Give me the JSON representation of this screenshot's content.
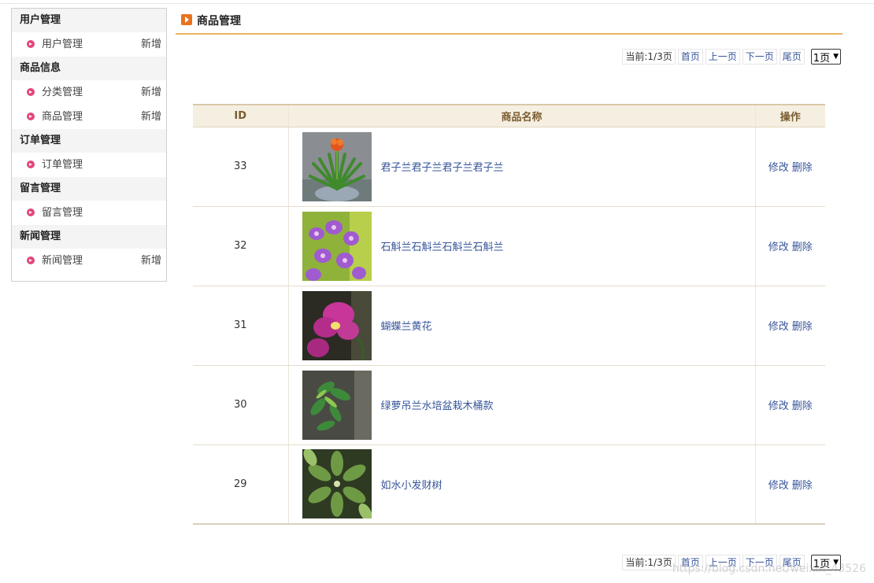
{
  "sidebar": {
    "groups": [
      {
        "title": "用户管理",
        "items": [
          {
            "label": "用户管理",
            "add": "新增"
          }
        ]
      },
      {
        "title": "商品信息",
        "items": [
          {
            "label": "分类管理",
            "add": "新增"
          },
          {
            "label": "商品管理",
            "add": "新增"
          }
        ]
      },
      {
        "title": "订单管理",
        "items": [
          {
            "label": "订单管理",
            "add": ""
          }
        ]
      },
      {
        "title": "留言管理",
        "items": [
          {
            "label": "留言管理",
            "add": ""
          }
        ]
      },
      {
        "title": "新闻管理",
        "items": [
          {
            "label": "新闻管理",
            "add": "新增"
          }
        ]
      }
    ]
  },
  "header": {
    "title": "商品管理"
  },
  "pager": {
    "current": "当前:1/3页",
    "first": "首页",
    "prev": "上一页",
    "next": "下一页",
    "last": "尾页",
    "select_value": "1页"
  },
  "table": {
    "headers": {
      "id": "ID",
      "name": "商品名称",
      "op": "操作"
    },
    "rows": [
      {
        "id": "33",
        "name": "君子兰君子兰君子兰君子兰",
        "edit": "修改",
        "delete": "删除",
        "thumb": "clivia-plant-image"
      },
      {
        "id": "32",
        "name": "石斛兰石斛兰石斛兰石斛兰",
        "edit": "修改",
        "delete": "删除",
        "thumb": "dendrobium-orchid-image"
      },
      {
        "id": "31",
        "name": "蝴蝶兰黄花",
        "edit": "修改",
        "delete": "删除",
        "thumb": "phalaenopsis-orchid-image"
      },
      {
        "id": "30",
        "name": "绿萝吊兰水培盆栽木桶款",
        "edit": "修改",
        "delete": "删除",
        "thumb": "pothos-spider-plant-image"
      },
      {
        "id": "29",
        "name": "如水小发财树",
        "edit": "修改",
        "delete": "删除",
        "thumb": "money-tree-image"
      }
    ]
  },
  "watermark": "https://blog.csdn.net/weixin_43526",
  "colors": {
    "accent": "#e7b45f",
    "link": "#36549a",
    "bullet": "#e0467a",
    "header_bg": "#f5efe2"
  }
}
